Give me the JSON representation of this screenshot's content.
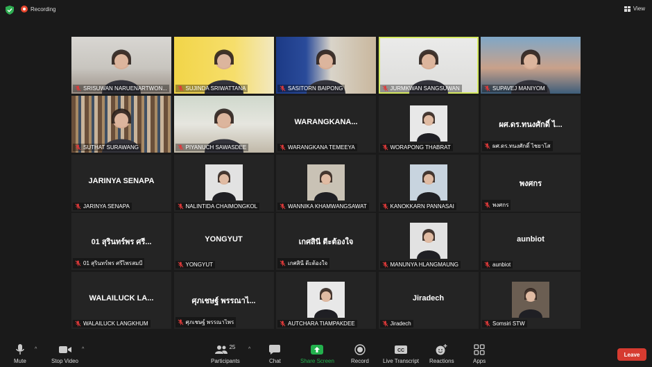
{
  "topbar": {
    "recording_label": "Recording",
    "view_label": "View"
  },
  "participants": [
    {
      "name": "SRISUWAN NARUENARTWON...",
      "video": true,
      "scene": "bright-office"
    },
    {
      "name": "SUJINDA SRIWATTANA",
      "video": true,
      "scene": "yellow-slide"
    },
    {
      "name": "SASITORN BAIPONG",
      "video": true,
      "scene": "blue-room"
    },
    {
      "name": "JURMKWAN SANGSUWAN",
      "video": true,
      "scene": "white-wall",
      "active": true
    },
    {
      "name": "SUPAVEJ MANIYOM",
      "video": true,
      "scene": "sunset-bridge"
    },
    {
      "name": "SUTHAT SURAWANG",
      "video": true,
      "scene": "bookshelf"
    },
    {
      "name": "PIYANUCH SAWASDEE",
      "video": true,
      "scene": "window-room"
    },
    {
      "name": "WARANGKANA TEMEEYA",
      "video": false,
      "display": "WARANGKANA..."
    },
    {
      "name": "WORAPONG THABRAT",
      "video": false,
      "photo": true
    },
    {
      "name": "ผศ.ดร.ทนงศักดิ์ ไชยาโส",
      "video": false,
      "display": "ผศ.ดร.ทนงศักดิ์ ไ..."
    },
    {
      "name": "JARINYA SENAPA",
      "video": false,
      "display": "JARINYA SENAPA"
    },
    {
      "name": "NALINTIDA CHAIMONGKOL",
      "video": false,
      "photo": true
    },
    {
      "name": "WANNIKA KHAMWANGSAWAT",
      "video": false,
      "photo": true
    },
    {
      "name": "KANOKKARN PANNASAI",
      "video": false,
      "photo": true
    },
    {
      "name": "พงศกร",
      "video": false,
      "display": "พงศกร"
    },
    {
      "name": "01 สุรินทร์พร ศรีไพรสมบี",
      "video": false,
      "display": "01 สุรินทร์พร ศรี..."
    },
    {
      "name": "YONGYUT",
      "video": false,
      "display": "YONGYUT"
    },
    {
      "name": "เกศสินี ตีะต้องใจ",
      "video": false,
      "display": "เกศสินี ตีะต้องใจ"
    },
    {
      "name": "MANUNYA HLANGMAUNG",
      "video": false,
      "photo": true
    },
    {
      "name": "aunbiot",
      "video": false,
      "display": "aunbiot"
    },
    {
      "name": "WALAILUCK LANGKHUM",
      "video": false,
      "display": "WALAILUCK LA..."
    },
    {
      "name": "ศุภเชษฐ์ พรรณาไพร",
      "video": false,
      "display": "ศุภเชษฐ์ พรรณาไ..."
    },
    {
      "name": "AUTCHARA TIAMPAKDEE",
      "video": false,
      "photo": true
    },
    {
      "name": "Jiradech",
      "video": false,
      "display": "Jiradech"
    },
    {
      "name": "Somsiri STW",
      "video": false,
      "photo": true
    }
  ],
  "toolbar": {
    "mute": "Mute",
    "stop_video": "Stop Video",
    "participants": "Participants",
    "participants_count": "25",
    "chat": "Chat",
    "share_screen": "Share Screen",
    "record": "Record",
    "live_transcript": "Live Transcript",
    "reactions": "Reactions",
    "apps": "Apps",
    "leave": "Leave"
  },
  "colors": {
    "active_speaker_outline": "#d4e85f",
    "share_green": "#23b14d",
    "leave_red": "#d63b30",
    "muted_red": "#e03a3a"
  }
}
